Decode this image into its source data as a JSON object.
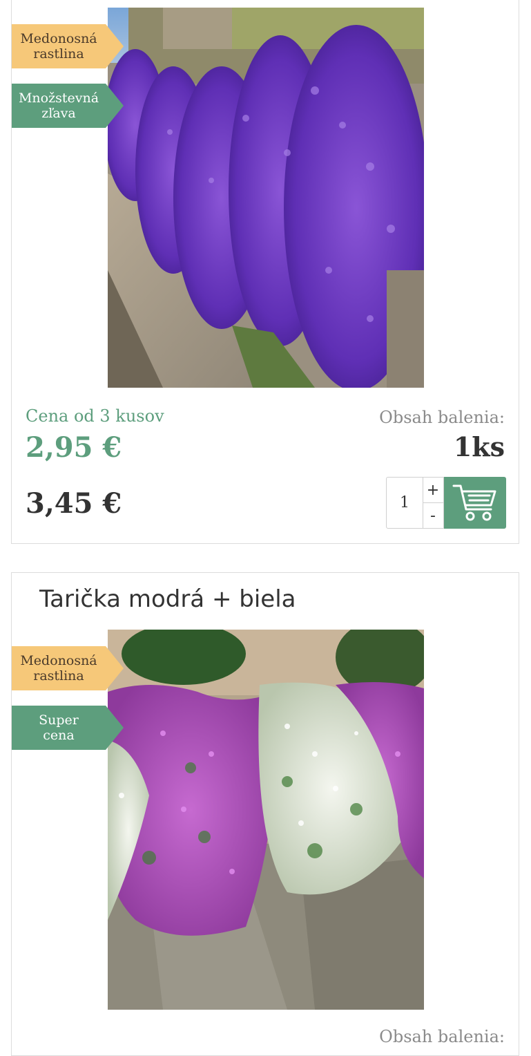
{
  "products": [
    {
      "image_alt": "Taričkový záhon fialový",
      "badges": [
        "Medonosná rastlina",
        "Množstevná zľava"
      ],
      "price_from_label": "Cena od 3 kusov",
      "price_discount": "2,95 €",
      "price_regular": "3,45 €",
      "package_label": "Obsah balenia:",
      "package_value": "1ks",
      "quantity": "1",
      "plus_label": "+",
      "minus_label": "-"
    },
    {
      "title": "Tarička modrá + biela",
      "badges": [
        "Medonosná rastlina",
        "Super cena"
      ],
      "package_label": "Obsah balenia:"
    }
  ],
  "colors": {
    "accent": "#5d9e7d",
    "badge_yellow": "#f6c879",
    "text_dark": "#333333",
    "text_muted": "#8a8a8a"
  }
}
